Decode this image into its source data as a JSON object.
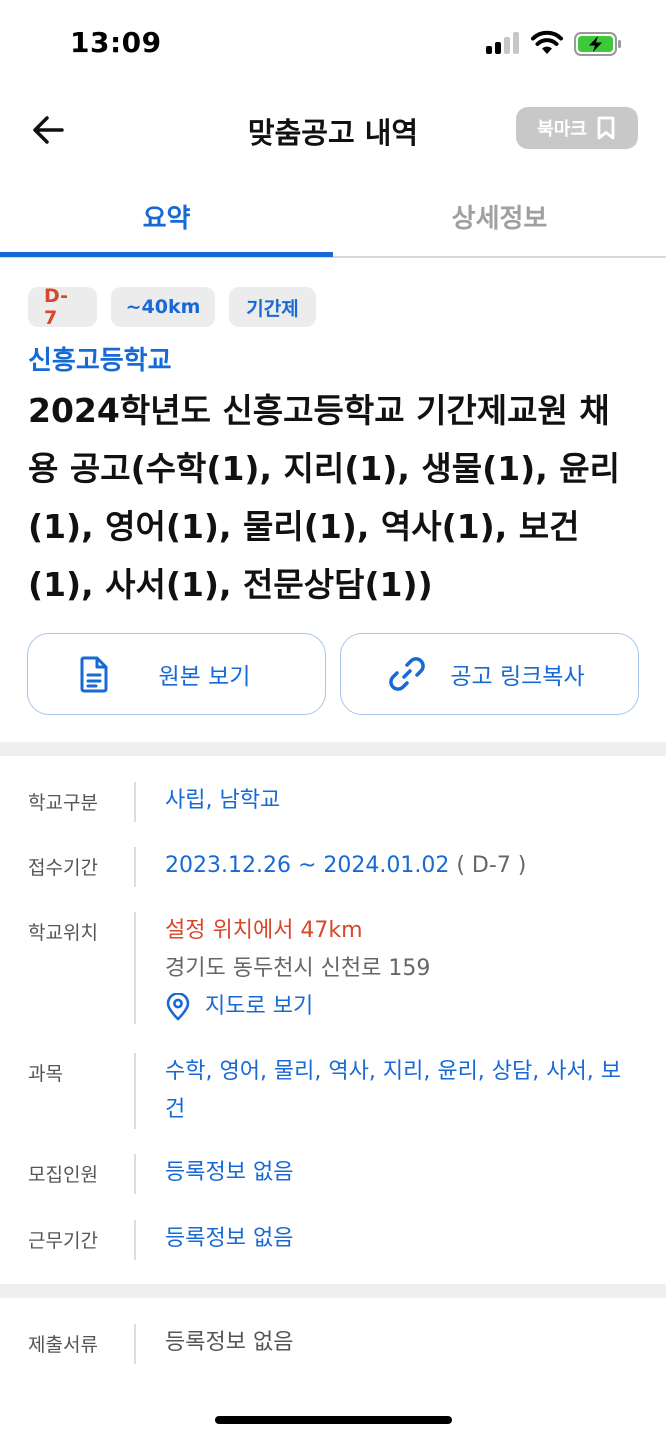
{
  "status": {
    "time": "13:09"
  },
  "nav": {
    "title": "맞춤공고 내역",
    "bookmark_label": "북마크"
  },
  "tabs": [
    {
      "label": "요약"
    },
    {
      "label": "상세정보"
    }
  ],
  "chips": {
    "dday": "D-7",
    "distance": "~40km",
    "type": "기간제"
  },
  "school_name": "신흥고등학교",
  "post_title": "2024학년도 신흥고등학교 기간제교원 채용 공고(수학(1), 지리(1), 생물(1), 윤리(1), 영어(1), 물리(1), 역사(1), 보건(1), 사서(1), 전문상담(1))",
  "actions": {
    "original": "원본 보기",
    "copy_link": "공고 링크복사"
  },
  "info": {
    "school_type_label": "학교구분",
    "school_type_value": "사립, 남학교",
    "period_label": "접수기간",
    "period_value": "2023.12.26 ~ 2024.01.02",
    "period_dday": "( D-7 )",
    "location_label": "학교위치",
    "location_distance": "설정 위치에서 47km",
    "location_address": "경기도 동두천시 신천로 159",
    "location_map": "지도로 보기",
    "subject_label": "과목",
    "subject_value": "수학, 영어, 물리, 역사, 지리, 윤리, 상담, 사서, 보건",
    "recruit_label": "모집인원",
    "recruit_value": "등록정보 없음",
    "work_label": "근무기간",
    "work_value": "등록정보 없음"
  },
  "documents": {
    "label": "제출서류",
    "value": "등록정보 없음"
  },
  "colors": {
    "accent": "#1769d6",
    "danger": "#d7472a",
    "chip_bg": "#ececec",
    "battery": "#3ec93a"
  },
  "icons": [
    "back-arrow-icon",
    "bookmark-icon",
    "document-icon",
    "link-icon",
    "location-pin-icon"
  ]
}
